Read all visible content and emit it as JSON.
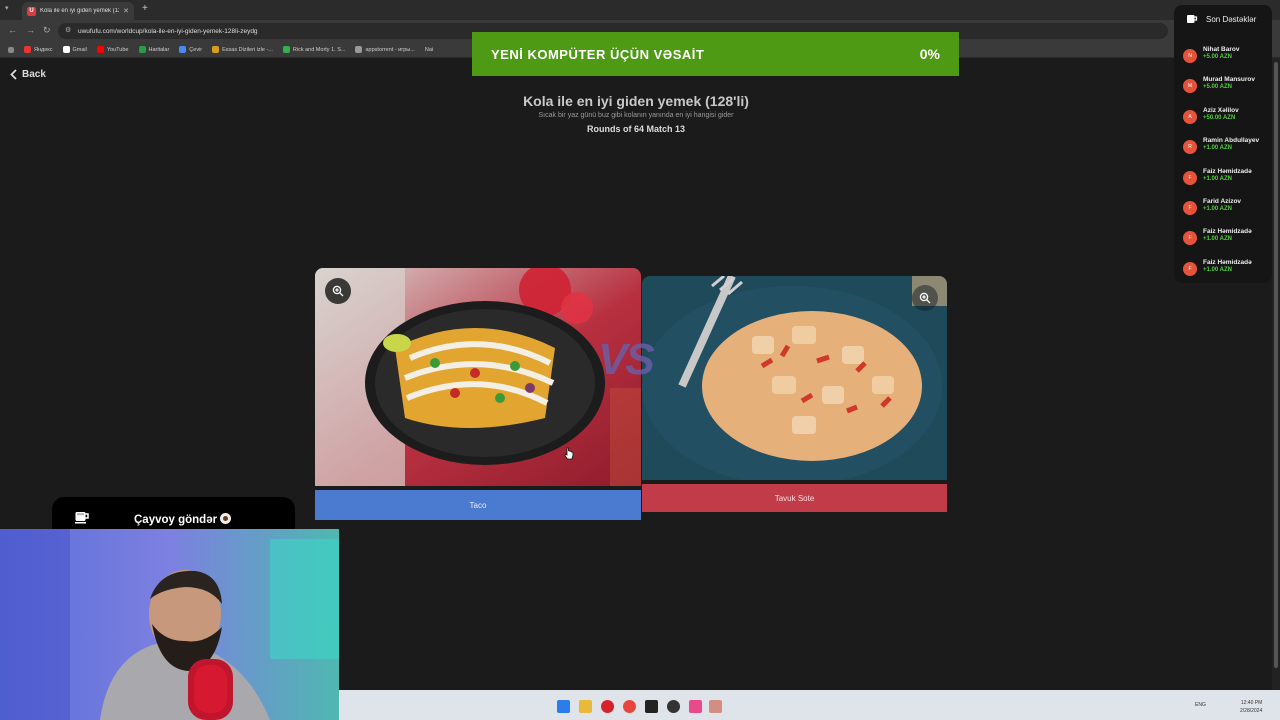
{
  "browser": {
    "tab_title": "Kola ile en iyi giden yemek (12...",
    "url": "uwufufu.com/worldcup/kola-ile-en-iyi-giden-yemek-128li-zeydg",
    "bookmarks": [
      "Яндекс",
      "Gmail",
      "YouTube",
      "Haritalar",
      "Çevir",
      "Essas Dizileri izle -...",
      "Rick and Morty 1. S...",
      "appstorrent - игры...",
      "Nai"
    ]
  },
  "page": {
    "back_label": "Back",
    "title": "Kola ile en iyi giden yemek (128'li)",
    "subtitle": "Sıcak bir yaz günü buz gibi kolanın yanında en iyi hangisi gider",
    "rounds": "Rounds of 64 Match 13",
    "vs_label": "VS",
    "left_choice": "Taco",
    "right_choice": "Tavuk Sote"
  },
  "banner": {
    "title": "YENİ KOMPÜTER ÜÇÜN VƏSAİT",
    "percent": "0%",
    "progress": 0,
    "color": "#4f9a14"
  },
  "supporters": {
    "heading": "Son Dəstəklər",
    "items": [
      {
        "initial": "N",
        "name": "Nihat Barov",
        "amount": "+5.00 AZN"
      },
      {
        "initial": "M",
        "name": "Murad Mansurov",
        "amount": "+5.00 AZN"
      },
      {
        "initial": "A",
        "name": "Aziz Xəlilov",
        "amount": "+50.00 AZN"
      },
      {
        "initial": "R",
        "name": "Ramin Abdullayev",
        "amount": "+1.00 AZN"
      },
      {
        "initial": "F",
        "name": "Faiz Həmidzadə",
        "amount": "+1.00 AZN"
      },
      {
        "initial": "F",
        "name": "Farid Azizov",
        "amount": "+1.00 AZN"
      },
      {
        "initial": "F",
        "name": "Faiz Həmidzadə",
        "amount": "+1.00 AZN"
      },
      {
        "initial": "F",
        "name": "Faiz Həmidzadə",
        "amount": "+1.00 AZN"
      }
    ]
  },
  "chay": {
    "label": "Çayvoy göndər"
  },
  "taskbar": {
    "lang": "ENG",
    "time": "12:40 PM",
    "date": "2/28/2024"
  },
  "colors": {
    "left_button": "#4a7bd0",
    "right_button": "#c13c48",
    "donation_amount": "#4fd13c"
  }
}
